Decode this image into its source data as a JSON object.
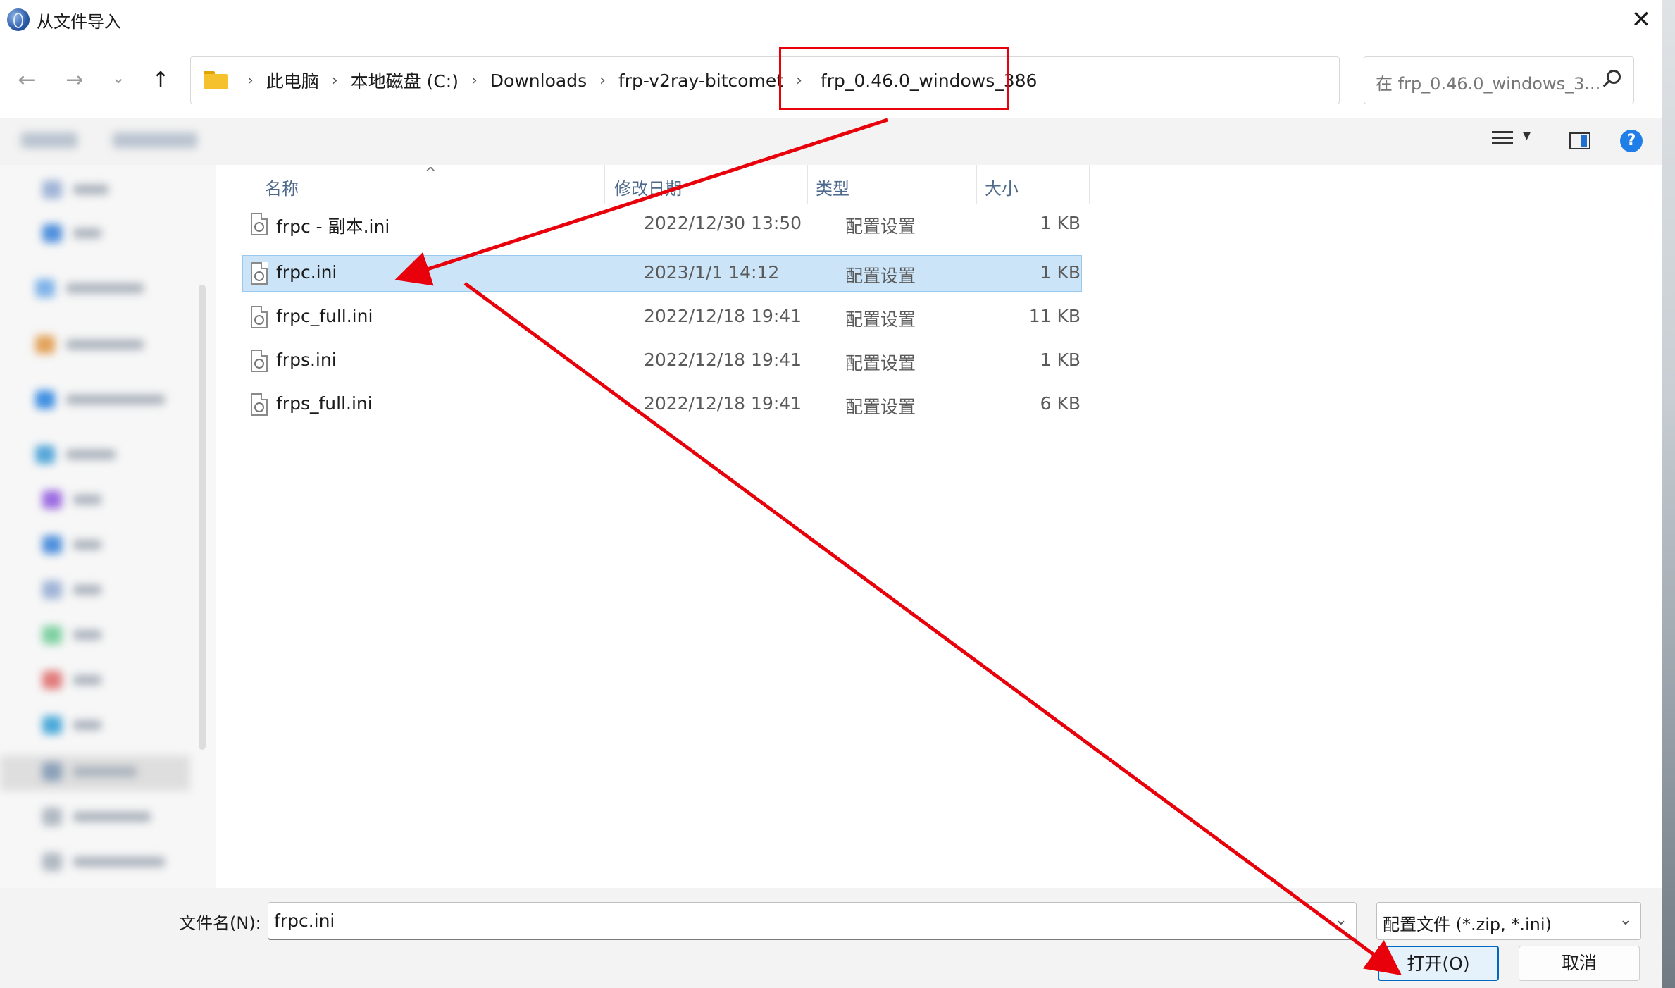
{
  "window": {
    "title": "从文件导入",
    "close_glyph": "✕"
  },
  "nav": {
    "back_glyph": "←",
    "forward_glyph": "→",
    "recent_glyph": "⌄",
    "up_glyph": "↑"
  },
  "address": {
    "crumbs": [
      "此电脑",
      "本地磁盘 (C:)",
      "Downloads",
      "frp-v2ray-bitcomet",
      "frp_0.46.0_windows_386"
    ],
    "separator": "›",
    "dropdown_glyph": "⌄",
    "refresh_glyph": "↻"
  },
  "search": {
    "placeholder": "在 frp_0.46.0_windows_3..."
  },
  "toolbar": {
    "view_dropdown_glyph": "▾",
    "help_glyph": "?"
  },
  "columns": {
    "name": "名称",
    "date": "修改日期",
    "type": "类型",
    "size": "大小",
    "sort_glyph": "^"
  },
  "files": [
    {
      "name": "frpc - 副本.ini",
      "date": "2022/12/30 13:50",
      "type": "配置设置",
      "size": "1 KB"
    },
    {
      "name": "frpc.ini",
      "date": "2023/1/1 14:12",
      "type": "配置设置",
      "size": "1 KB"
    },
    {
      "name": "frpc_full.ini",
      "date": "2022/12/18 19:41",
      "type": "配置设置",
      "size": "11 KB"
    },
    {
      "name": "frps.ini",
      "date": "2022/12/18 19:41",
      "type": "配置设置",
      "size": "1 KB"
    },
    {
      "name": "frps_full.ini",
      "date": "2022/12/18 19:41",
      "type": "配置设置",
      "size": "6 KB"
    }
  ],
  "selected_index": 1,
  "bottom": {
    "filename_label": "文件名(N):",
    "filename_value": "frpc.ini",
    "filetype_value": "配置文件 (*.zip, *.ini)",
    "dropdown_glyph": "⌄",
    "open_label": "打开(O)",
    "cancel_label": "取消"
  },
  "colors": {
    "annotation": "#e8000b",
    "selection": "#cce4f7",
    "accent": "#0067c0"
  }
}
